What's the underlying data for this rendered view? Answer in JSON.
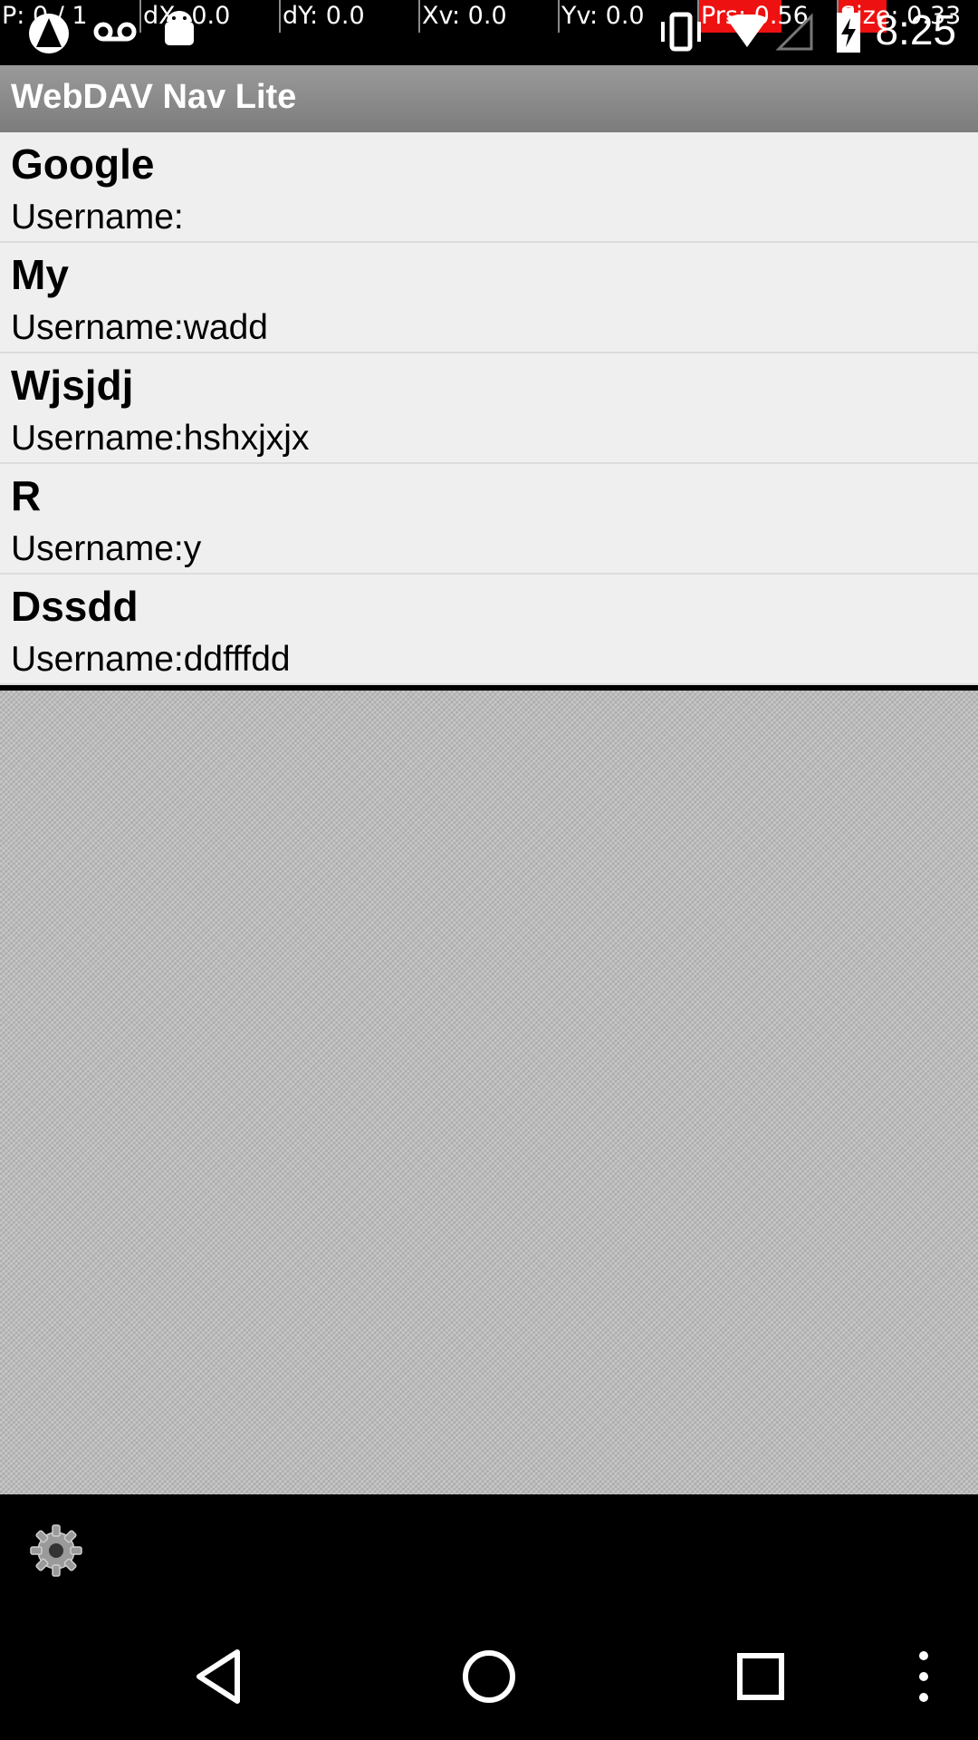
{
  "status_bar": {
    "debug_cells": [
      "P: 0 / 1",
      "dX: 0.0",
      "dY: 0.0",
      "Xv: 0.0",
      "Yv: 0.0",
      "Prs: 0.56",
      "Size: 0.33"
    ],
    "time": "8:25",
    "icons": [
      "app-icon",
      "voicemail-icon",
      "android-icon",
      "vibrate-icon",
      "wifi-icon",
      "signal-icon",
      "battery-charging-icon"
    ]
  },
  "app": {
    "title": "WebDAV Nav Lite"
  },
  "servers": [
    {
      "name": "Google",
      "username": "Username:"
    },
    {
      "name": "My",
      "username": "Username:wadd"
    },
    {
      "name": "Wjsjdj",
      "username": "Username:hshxjxjx"
    },
    {
      "name": "R",
      "username": "Username:y"
    },
    {
      "name": "Dssdd",
      "username": "Username:ddfffdd"
    }
  ],
  "bottom_bar": {
    "settings_icon": "gear-icon"
  },
  "nav": {
    "icons": [
      "back-icon",
      "home-icon",
      "recents-icon",
      "overflow-menu-icon"
    ]
  }
}
